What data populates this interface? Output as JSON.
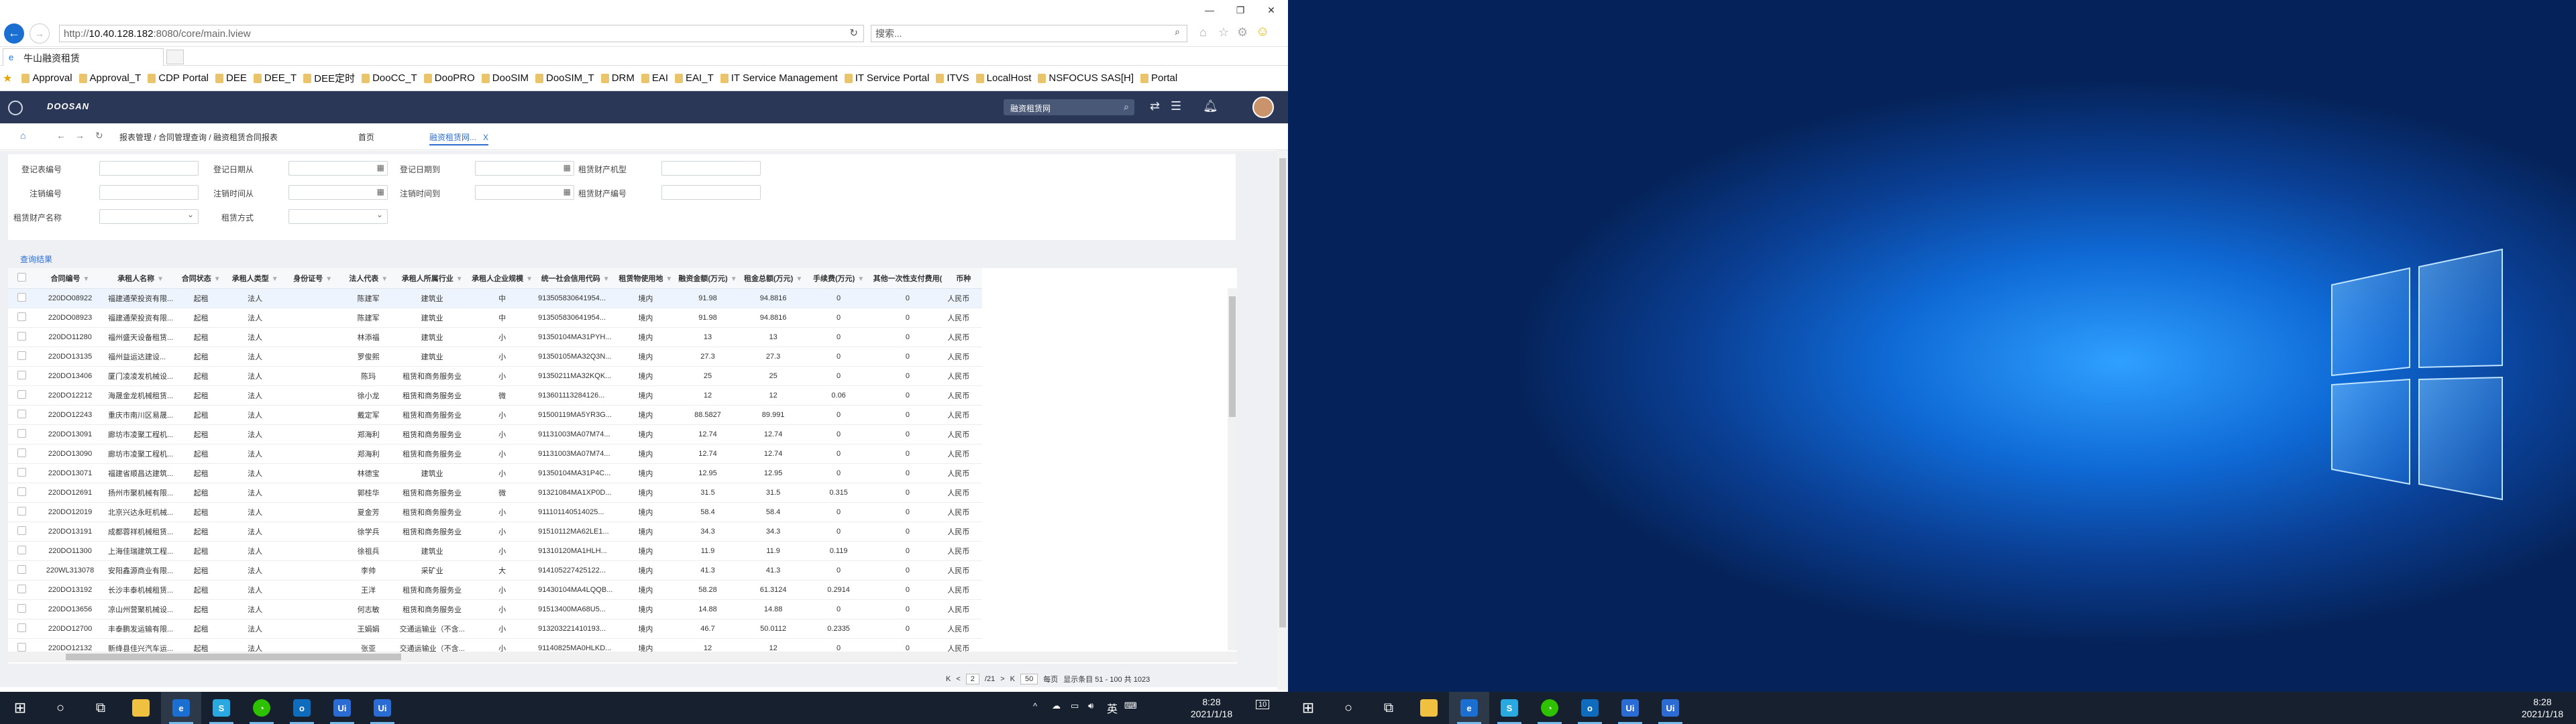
{
  "browser": {
    "tab_title": "牛山融资租赁",
    "address_prefix": "http://",
    "address_host": "10.40.128.182",
    "address_rest": ":8080/core/main.lview",
    "search_placeholder": "搜索...",
    "window_controls": {
      "minimize": "—",
      "maximize": "❐",
      "close": "✕"
    }
  },
  "favorites": [
    "Approval",
    "Approval_T",
    "CDP Portal",
    "DEE",
    "DEE_T",
    "DEE定时",
    "DooCC_T",
    "DooPRO",
    "DooSIM",
    "DooSIM_T",
    "DRM",
    "EAI",
    "EAI_T",
    "IT Service Management",
    "IT Service Portal",
    "ITVS",
    "LocalHost",
    "NSFOCUS SAS[H]",
    "Portal"
  ],
  "app": {
    "brand": "DOOSAN",
    "search_placeholder": "融资租赁网",
    "breadcrumb": "报表管理 / 合同管理查询 / 融资租赁合同报表",
    "tab_home": "首页",
    "tab_current": "融资租赁网...",
    "tab_close": "X"
  },
  "filters": {
    "row1": [
      "登记表编号",
      "登记日期从",
      "登记日期到",
      "租赁财产机型"
    ],
    "row2": [
      "注销编号",
      "注销时间从",
      "注销时间到",
      "租赁财产编号"
    ],
    "row3": [
      "租赁财产名称",
      "租赁方式"
    ]
  },
  "results_label": "查询结果",
  "table": {
    "headers": [
      "合同编号",
      "承租人名称",
      "合同状态",
      "承租人类型",
      "身份证号",
      "法人代表",
      "承租人所属行业",
      "承租人企业规模",
      "统一社会信用代码",
      "租赁物使用地",
      "融资金额(万元)",
      "租金总额(万元)",
      "手续费(万元)",
      "其他一次性支付费用(",
      "币种"
    ],
    "rows": [
      [
        "220DO08922",
        "福建通荣投资有限...",
        "起租",
        "法人",
        "",
        "陈建军",
        "建筑业",
        "中",
        "913505830641954...",
        "境内",
        "91.98",
        "94.8816",
        "0",
        "0",
        "人民币"
      ],
      [
        "220DO08923",
        "福建通荣投资有限...",
        "起租",
        "法人",
        "",
        "陈建军",
        "建筑业",
        "中",
        "913505830641954...",
        "境内",
        "91.98",
        "94.8816",
        "0",
        "0",
        "人民币"
      ],
      [
        "220DO11280",
        "福州盛天设备租赁...",
        "起租",
        "法人",
        "",
        "林添福",
        "建筑业",
        "小",
        "91350104MA31PYH...",
        "境内",
        "13",
        "13",
        "0",
        "0",
        "人民币"
      ],
      [
        "220DO13135",
        "福州益运达建设...",
        "起租",
        "法人",
        "",
        "罗俊熙",
        "建筑业",
        "小",
        "91350105MA32Q3N...",
        "境内",
        "27.3",
        "27.3",
        "0",
        "0",
        "人民币"
      ],
      [
        "220DO13406",
        "厦门凌凌发机械设...",
        "起租",
        "法人",
        "",
        "陈玛",
        "租赁和商务服务业",
        "小",
        "91350211MA32KQK...",
        "境内",
        "25",
        "25",
        "0",
        "0",
        "人民币"
      ],
      [
        "220DO12212",
        "海晟金龙机械租赁...",
        "起租",
        "法人",
        "",
        "徐小龙",
        "租赁和商务服务业",
        "微",
        "913601113284126...",
        "境内",
        "12",
        "12",
        "0.06",
        "0",
        "人民币"
      ],
      [
        "220DO12243",
        "重庆市南川区易晟...",
        "起租",
        "法人",
        "",
        "戴定军",
        "租赁和商务服务业",
        "小",
        "91500119MA5YR3G...",
        "境内",
        "88.5827",
        "89.991",
        "0",
        "0",
        "人民币"
      ],
      [
        "220DO13091",
        "廊坊市凌聚工程机...",
        "起租",
        "法人",
        "",
        "郑海利",
        "租赁和商务服务业",
        "小",
        "91131003MA07M74...",
        "境内",
        "12.74",
        "12.74",
        "0",
        "0",
        "人民币"
      ],
      [
        "220DO13090",
        "廊坊市凌聚工程机...",
        "起租",
        "法人",
        "",
        "郑海利",
        "租赁和商务服务业",
        "小",
        "91131003MA07M74...",
        "境内",
        "12.74",
        "12.74",
        "0",
        "0",
        "人民币"
      ],
      [
        "220DO13071",
        "福建省顺昌达建筑...",
        "起租",
        "法人",
        "",
        "林德宝",
        "建筑业",
        "小",
        "91350104MA31P4C...",
        "境内",
        "12.95",
        "12.95",
        "0",
        "0",
        "人民币"
      ],
      [
        "220DO12691",
        "扬州市聚机械有限...",
        "起租",
        "法人",
        "",
        "郭桂华",
        "租赁和商务服务业",
        "微",
        "91321084MA1XP0D...",
        "境内",
        "31.5",
        "31.5",
        "0.315",
        "0",
        "人民币"
      ],
      [
        "220DO12019",
        "北京兴达永旺机械...",
        "起租",
        "法人",
        "",
        "夏金芳",
        "租赁和商务服务业",
        "小",
        "911101140514025...",
        "境内",
        "58.4",
        "58.4",
        "0",
        "0",
        "人民币"
      ],
      [
        "220DO13191",
        "成都蓉祥机械租赁...",
        "起租",
        "法人",
        "",
        "徐学兵",
        "租赁和商务服务业",
        "小",
        "91510112MA62LE1...",
        "境内",
        "34.3",
        "34.3",
        "0",
        "0",
        "人民币"
      ],
      [
        "220DO11300",
        "上海佳瑞建筑工程...",
        "起租",
        "法人",
        "",
        "徐祖兵",
        "建筑业",
        "小",
        "91310120MA1HLH...",
        "境内",
        "11.9",
        "11.9",
        "0.119",
        "0",
        "人民币"
      ],
      [
        "220WL313078",
        "安阳鑫源商业有限...",
        "起租",
        "法人",
        "",
        "李帅",
        "采矿业",
        "大",
        "914105227425122...",
        "境内",
        "41.3",
        "41.3",
        "0",
        "0",
        "人民币"
      ],
      [
        "220DO13192",
        "长沙丰泰机械租赁...",
        "起租",
        "法人",
        "",
        "王洋",
        "租赁和商务服务业",
        "小",
        "91430104MA4LQQB...",
        "境内",
        "58.28",
        "61.3124",
        "0.2914",
        "0",
        "人民币"
      ],
      [
        "220DO13656",
        "凉山州营聚机械设...",
        "起租",
        "法人",
        "",
        "何志敏",
        "租赁和商务服务业",
        "小",
        "91513400MA68U5...",
        "境内",
        "14.88",
        "14.88",
        "0",
        "0",
        "人民币"
      ],
      [
        "220DO12700",
        "丰泰鹏发运输有限...",
        "起租",
        "法人",
        "",
        "王娟娟",
        "交通运输业（不含...",
        "小",
        "913203221410193...",
        "境内",
        "46.7",
        "50.0112",
        "0.2335",
        "0",
        "人民币"
      ],
      [
        "220DO12132",
        "新绛县佳兴汽车运...",
        "起租",
        "法人",
        "",
        "张亚",
        "交通运输业（不含...",
        "小",
        "91140825MA0HLKD...",
        "境内",
        "12",
        "12",
        "0",
        "0",
        "人民币"
      ]
    ]
  },
  "pager": {
    "first": "K",
    "prev": "<",
    "current": "2",
    "total": "/21",
    "next": ">",
    "last": "K",
    "page_size": "50",
    "page_size_unit": "每页",
    "summary": "显示条目 51 - 100 共 1023"
  },
  "taskbar_left": {
    "lang": "英",
    "time": "8:28",
    "date": "2021/1/18",
    "badge": "10"
  },
  "taskbar_right": {
    "time": "8:28",
    "date": "2021/1/18"
  }
}
